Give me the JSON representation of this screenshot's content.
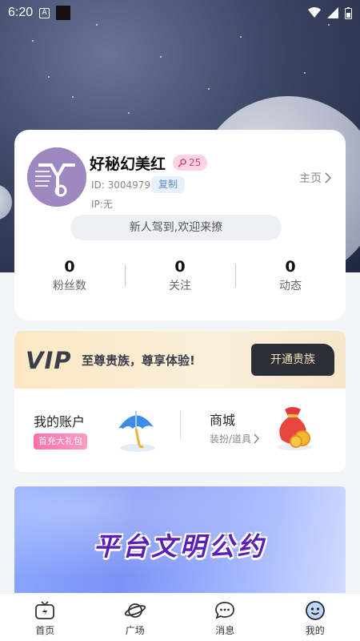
{
  "status_bar": {
    "time": "6:20",
    "notify_icon": "a-letter-icon"
  },
  "profile": {
    "name": "好秘幻美红",
    "level": "25",
    "id_label": "ID: 3004979",
    "copy_label": "复制",
    "ip_label": "IP:无",
    "homepage_label": "主页",
    "signature": "新人驾到,欢迎来撩"
  },
  "stats": [
    {
      "value": "0",
      "label": "粉丝数"
    },
    {
      "value": "0",
      "label": "关注"
    },
    {
      "value": "0",
      "label": "动态"
    }
  ],
  "vip": {
    "logo": "VIP",
    "slogan": "至尊贵族，尊享体验!",
    "button": "开通贵族"
  },
  "account": {
    "title": "我的账户",
    "badge": "首充大礼包"
  },
  "mall": {
    "title": "商城",
    "subtitle": "装扮/道具"
  },
  "banner": {
    "title": "平台文明公约"
  },
  "nav": [
    {
      "label": "首页",
      "icon": "tv-lightning-icon"
    },
    {
      "label": "广场",
      "icon": "planet-icon"
    },
    {
      "label": "消息",
      "icon": "chat-bubble-icon"
    },
    {
      "label": "我的",
      "icon": "smiley-face-icon"
    }
  ],
  "colors": {
    "accent_pink": "#d0457d",
    "vip_dark": "#2d2f38",
    "banner_text": "#5a1fb8"
  }
}
